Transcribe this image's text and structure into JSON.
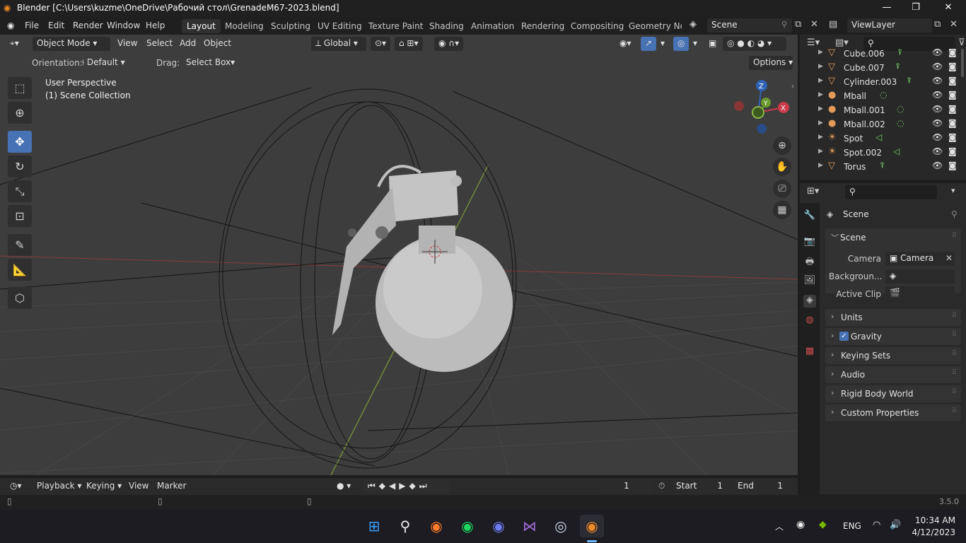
{
  "window": {
    "title": "Blender [C:\\Users\\kuzme\\OneDrive\\Рабочий стол\\GrenadeM67-2023.blend]"
  },
  "menu": [
    "File",
    "Edit",
    "Render",
    "Window",
    "Help"
  ],
  "workspaces": [
    "Layout",
    "Modeling",
    "Sculpting",
    "UV Editing",
    "Texture Paint",
    "Shading",
    "Animation",
    "Rendering",
    "Compositing",
    "Geometry Noc"
  ],
  "scene_field": "Scene",
  "viewlayer_field": "ViewLayer",
  "viewport": {
    "mode": "Object Mode",
    "menus": [
      "View",
      "Select",
      "Add",
      "Object"
    ],
    "transform": "Global",
    "orientation_label": "Orientation:",
    "orientation_value": "Default",
    "drag_label": "Drag:",
    "drag_value": "Select Box",
    "options": "Options",
    "info_line1": "User Perspective",
    "info_line2": "(1) Scene Collection",
    "gizmo": {
      "z": "Z",
      "y": "Y",
      "x": "X"
    }
  },
  "outliner": {
    "items": [
      {
        "name": "Cube.006",
        "type": "mesh"
      },
      {
        "name": "Cube.007",
        "type": "mesh"
      },
      {
        "name": "Cylinder.003",
        "type": "mesh"
      },
      {
        "name": "Mball",
        "type": "meta"
      },
      {
        "name": "Mball.001",
        "type": "meta"
      },
      {
        "name": "Mball.002",
        "type": "meta"
      },
      {
        "name": "Spot",
        "type": "light"
      },
      {
        "name": "Spot.002",
        "type": "light"
      },
      {
        "name": "Torus",
        "type": "mesh"
      }
    ]
  },
  "properties": {
    "header": "Scene",
    "section": "Scene",
    "camera_label": "Camera",
    "camera_value": "Camera",
    "background_label": "Backgroun...",
    "active_clip_label": "Active Clip",
    "panels": [
      "Units",
      "Gravity",
      "Keying Sets",
      "Audio",
      "Rigid Body World",
      "Custom Properties"
    ],
    "gravity_checked": true
  },
  "timeline": {
    "menus": [
      "Playback",
      "Keying",
      "View",
      "Marker"
    ],
    "current_frame": "1",
    "start_label": "Start",
    "start_value": "1",
    "end_label": "End",
    "end_value": "1"
  },
  "status": {
    "version": "3.5.0"
  },
  "taskbar": {
    "lang": "ENG",
    "time": "10:34 AM",
    "date": "4/12/2023"
  },
  "colors": {
    "accent": "#4772b3",
    "header": "#303030",
    "viewport": "#3d3d3d",
    "outliner_icon": "#e39a59",
    "constraint": "#7ed36f"
  }
}
